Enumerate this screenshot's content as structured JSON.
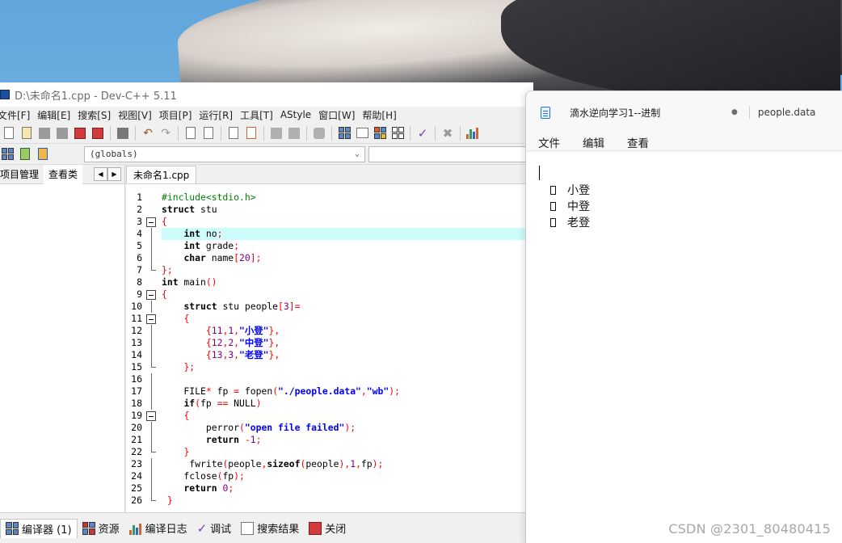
{
  "devcpp": {
    "title": "D:\\未命名1.cpp - Dev-C++ 5.11",
    "menu": [
      "文件[F]",
      "编辑[E]",
      "搜索[S]",
      "视图[V]",
      "项目[P]",
      "运行[R]",
      "工具[T]",
      "AStyle",
      "窗口[W]",
      "帮助[H]"
    ],
    "globals_select": "(globals)",
    "left_tabs": [
      "项目管理",
      "查看类"
    ],
    "file_tab": "未命名1.cpp",
    "line_numbers": [
      "1",
      "2",
      "3",
      "4",
      "5",
      "6",
      "7",
      "8",
      "9",
      "10",
      "11",
      "12",
      "13",
      "14",
      "15",
      "16",
      "17",
      "18",
      "19",
      "20",
      "21",
      "22",
      "23",
      "24",
      "25",
      "26"
    ],
    "code": [
      "#include<stdio.h>",
      "struct stu",
      "{",
      "    int no;",
      "    int grade;",
      "    char name[20];",
      "};",
      "int main()",
      "{",
      "    struct stu people[3]=",
      "    {",
      "        {11,1,\"小登\"},",
      "        {12,2,\"中登\"},",
      "        {13,3,\"老登\"},",
      "    };",
      "",
      "    FILE* fp = fopen(\"./people.data\",\"wb\");",
      "    if(fp == NULL)",
      "    {",
      "        perror(\"open file failed\");",
      "        return -1;",
      "    }",
      "     fwrite(people,sizeof(people),1,fp);",
      "    fclose(fp);",
      "    return 0;",
      " }"
    ],
    "highlighted_line": 4,
    "bottom_tabs": [
      "编译器 (1)",
      "资源",
      "编译日志",
      "调试",
      "搜索结果",
      "关闭"
    ]
  },
  "notepad": {
    "tab_title": "滴水逆向学习1--进制",
    "tab_dot": "●",
    "second_tab": "people.data",
    "menu": [
      "文件",
      "编辑",
      "查看"
    ],
    "lines": [
      "小登",
      "中登",
      "老登"
    ]
  },
  "watermark": "CSDN @2301_80480415",
  "colors": {
    "highlight_line": "#ccfcfc",
    "string": "#0000ff",
    "preprocessor": "#008000",
    "number": "#800080",
    "symbol": "#ff0000"
  }
}
